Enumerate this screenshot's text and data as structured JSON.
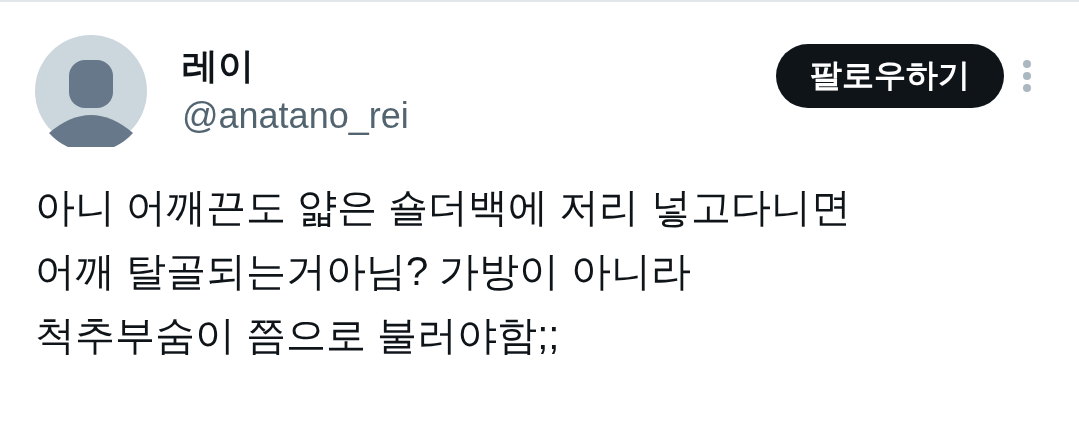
{
  "author": {
    "name": "레이",
    "handle": "@anatano_rei"
  },
  "follow_button": {
    "label": "팔로우하기"
  },
  "post": {
    "lines": [
      "아니 어깨끈도 얇은 숄더백에 저리 넣고다니면",
      "어깨 탈골되는거아님? 가방이 아니라",
      "척추부숨이 쯤으로 불러야함;;"
    ]
  }
}
